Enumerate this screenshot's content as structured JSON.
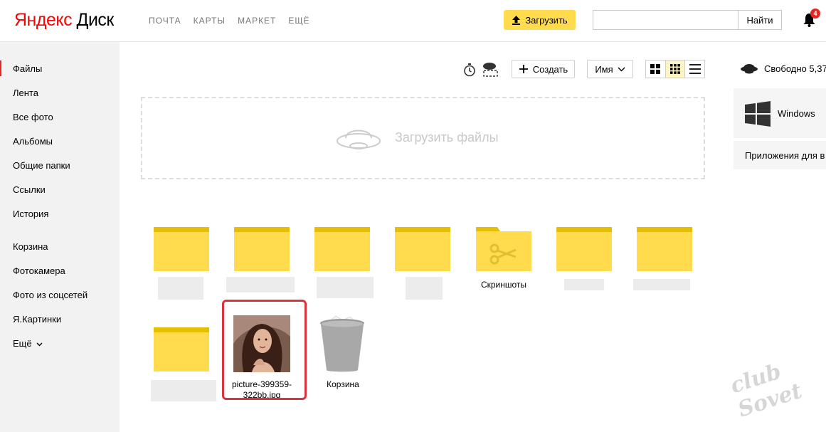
{
  "header": {
    "logo_ya": "Яндекс",
    "logo_disk": "Диск",
    "nav": [
      "ПОЧТА",
      "КАРТЫ",
      "МАРКЕТ",
      "ЕЩЁ"
    ],
    "upload_label": "Загрузить",
    "search_placeholder": "",
    "search_button": "Найти",
    "notifications_count": "4"
  },
  "sidebar": {
    "items": [
      "Файлы",
      "Лента",
      "Все фото",
      "Альбомы",
      "Общие папки",
      "Ссылки",
      "История",
      "Корзина",
      "Фотокамера",
      "Фото из соцсетей",
      "Я.Картинки",
      "Ещё"
    ],
    "active": "Файлы"
  },
  "toolbar": {
    "create_label": "Создать",
    "sort_label": "Имя",
    "icons": [
      "stopwatch-icon",
      "cloud-select-icon",
      "plus-icon",
      "chevron-down-icon",
      "view-large-icon",
      "view-grid-icon",
      "view-list-icon"
    ]
  },
  "dropzone": {
    "label": "Загрузить файлы",
    "icon": "disk-saucer-icon"
  },
  "files": [
    {
      "type": "folder",
      "label": ""
    },
    {
      "type": "folder",
      "label": ""
    },
    {
      "type": "folder",
      "label": ""
    },
    {
      "type": "folder",
      "label": ""
    },
    {
      "type": "folder-screenshots",
      "label": "Скриншоты"
    },
    {
      "type": "folder",
      "label": ""
    },
    {
      "type": "folder",
      "label": ""
    },
    {
      "type": "folder",
      "label": ""
    },
    {
      "type": "image",
      "label_line1": "picture-399359-",
      "label_line2": "322bb.jpg"
    },
    {
      "type": "trash",
      "label": "Корзина"
    }
  ],
  "right_panel": {
    "free_space": "Свободно 5,37",
    "promo_text": "Windows",
    "apps_text": "Приложения для в"
  },
  "watermark": "club Sovet",
  "colors": {
    "accent_yellow": "#ffdb4d",
    "folder_yellow": "#ffdb4d",
    "folder_tab": "#e6c000",
    "active_red": "#e52620",
    "highlight_red": "#d9333b"
  }
}
